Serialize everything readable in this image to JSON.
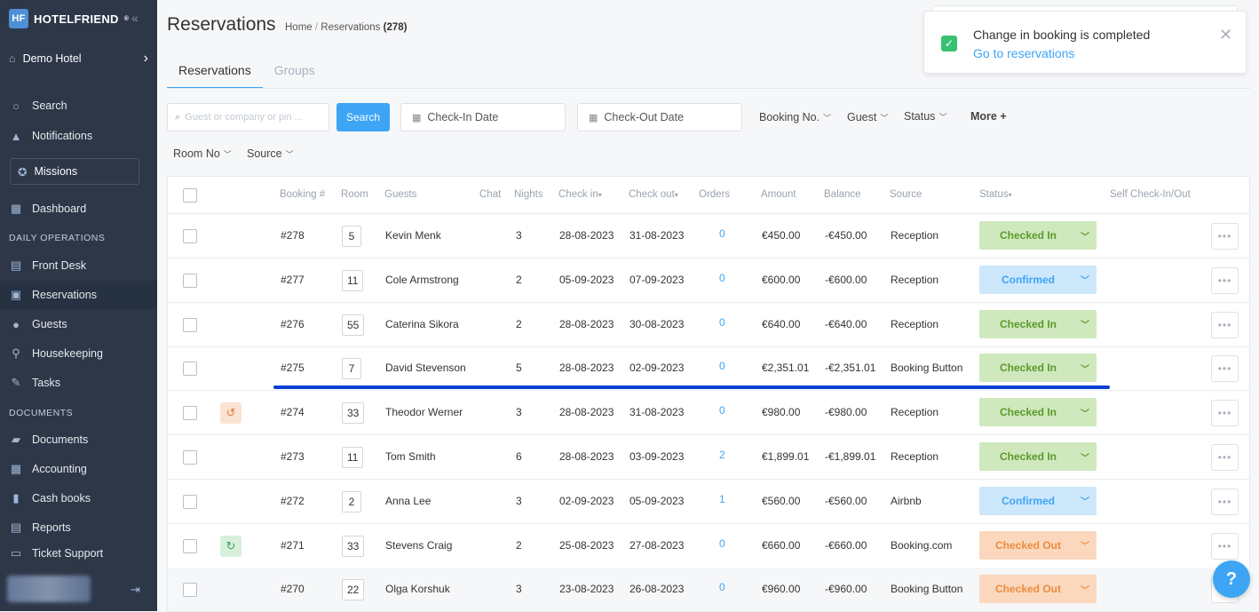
{
  "brand": {
    "name": "HOTELFRIEND",
    "mark": "HF"
  },
  "hotel": {
    "name": "Demo Hotel"
  },
  "sidebar": {
    "top": [
      {
        "label": "Search",
        "icon": "search-icon"
      },
      {
        "label": "Notifications",
        "icon": "bell-icon"
      }
    ],
    "missions": "Missions",
    "items_a": [
      {
        "label": "Dashboard",
        "icon": "dashboard-icon"
      }
    ],
    "section_ops": "DAILY OPERATIONS",
    "items_b": [
      {
        "label": "Front Desk",
        "icon": "front-desk-icon"
      },
      {
        "label": "Reservations",
        "icon": "reservations-icon"
      },
      {
        "label": "Guests",
        "icon": "guests-icon"
      },
      {
        "label": "Housekeeping",
        "icon": "housekeeping-icon"
      },
      {
        "label": "Tasks",
        "icon": "tasks-icon"
      }
    ],
    "section_docs": "DOCUMENTS",
    "items_c": [
      {
        "label": "Documents",
        "icon": "folder-icon"
      },
      {
        "label": "Accounting",
        "icon": "accounting-icon"
      },
      {
        "label": "Cash books",
        "icon": "cash-book-icon"
      },
      {
        "label": "Reports",
        "icon": "reports-icon"
      },
      {
        "label": "Ticket Support",
        "icon": "ticket-support-icon"
      }
    ]
  },
  "page": {
    "title": "Reservations",
    "breadcrumb_home": "Home",
    "breadcrumb_sep": "/",
    "breadcrumb_current": "Reservations",
    "breadcrumb_count": "(278)",
    "tabs": [
      "Reservations",
      "Groups"
    ]
  },
  "filters": {
    "search_placeholder": "Guest or company or pin ...",
    "search_button": "Search",
    "checkin": "Check-In Date",
    "checkout": "Check-Out Date",
    "booking_no": "Booking No.",
    "guest": "Guest",
    "status": "Status",
    "more": "More +",
    "room_no": "Room No",
    "source": "Source"
  },
  "table": {
    "headers": {
      "booking": "Booking #",
      "room": "Room",
      "guests": "Guests",
      "chat": "Chat",
      "nights": "Nights",
      "checkin": "Check in",
      "checkout": "Check out",
      "orders": "Orders",
      "amount": "Amount",
      "balance": "Balance",
      "source": "Source",
      "status": "Status",
      "self": "Self Check-In/Out"
    },
    "rows": [
      {
        "booking": "#278",
        "room": "5",
        "guest": "Kevin Menk",
        "nights": "3",
        "checkin": "28-08-2023",
        "checkout": "31-08-2023",
        "orders": "0",
        "amount": "€450.00",
        "balance": "-€450.00",
        "source": "Reception",
        "status": "Checked In",
        "kind": "in",
        "badge": ""
      },
      {
        "booking": "#277",
        "room": "11",
        "guest": "Cole Armstrong",
        "nights": "2",
        "checkin": "05-09-2023",
        "checkout": "07-09-2023",
        "orders": "0",
        "amount": "€600.00",
        "balance": "-€600.00",
        "source": "Reception",
        "status": "Confirmed",
        "kind": "conf",
        "badge": ""
      },
      {
        "booking": "#276",
        "room": "55",
        "guest": "Caterina Sikora",
        "nights": "2",
        "checkin": "28-08-2023",
        "checkout": "30-08-2023",
        "orders": "0",
        "amount": "€640.00",
        "balance": "-€640.00",
        "source": "Reception",
        "status": "Checked In",
        "kind": "in",
        "badge": ""
      },
      {
        "booking": "#275",
        "room": "7",
        "guest": "David Stevenson",
        "nights": "5",
        "checkin": "28-08-2023",
        "checkout": "02-09-2023",
        "orders": "0",
        "amount": "€2,351.01",
        "balance": "-€2,351.01",
        "source": "Booking Button",
        "status": "Checked In",
        "kind": "in",
        "badge": ""
      },
      {
        "booking": "#274",
        "room": "33",
        "guest": "Theodor Werner",
        "nights": "3",
        "checkin": "28-08-2023",
        "checkout": "31-08-2023",
        "orders": "0",
        "amount": "€980.00",
        "balance": "-€980.00",
        "source": "Reception",
        "status": "Checked In",
        "kind": "in",
        "badge": "history"
      },
      {
        "booking": "#273",
        "room": "11",
        "guest": "Tom Smith",
        "nights": "6",
        "checkin": "28-08-2023",
        "checkout": "03-09-2023",
        "orders": "2",
        "amount": "€1,899.01",
        "balance": "-€1,899.01",
        "source": "Reception",
        "status": "Checked In",
        "kind": "in",
        "badge": ""
      },
      {
        "booking": "#272",
        "room": "2",
        "guest": "Anna Lee",
        "nights": "3",
        "checkin": "02-09-2023",
        "checkout": "05-09-2023",
        "orders": "1",
        "amount": "€560.00",
        "balance": "-€560.00",
        "source": "Airbnb",
        "status": "Confirmed",
        "kind": "conf",
        "badge": ""
      },
      {
        "booking": "#271",
        "room": "33",
        "guest": "Stevens Craig",
        "nights": "2",
        "checkin": "25-08-2023",
        "checkout": "27-08-2023",
        "orders": "0",
        "amount": "€660.00",
        "balance": "-€660.00",
        "source": "Booking.com",
        "status": "Checked Out",
        "kind": "out",
        "badge": "refresh"
      },
      {
        "booking": "#270",
        "room": "22",
        "guest": "Olga Korshuk",
        "nights": "3",
        "checkin": "23-08-2023",
        "checkout": "26-08-2023",
        "orders": "0",
        "amount": "€960.00",
        "balance": "-€960.00",
        "source": "Booking Button",
        "status": "Checked Out",
        "kind": "out",
        "badge": ""
      }
    ]
  },
  "toast": {
    "message": "Change in booking is completed",
    "link": "Go to reservations"
  },
  "help": "?",
  "colors": {
    "accent": "#3da5f4",
    "sidebar": "#2d3748",
    "checked_in": "#cfe8bd",
    "confirmed": "#cde7fb",
    "checked_out": "#fbd8bd",
    "highlight": "#0b3ed1"
  }
}
